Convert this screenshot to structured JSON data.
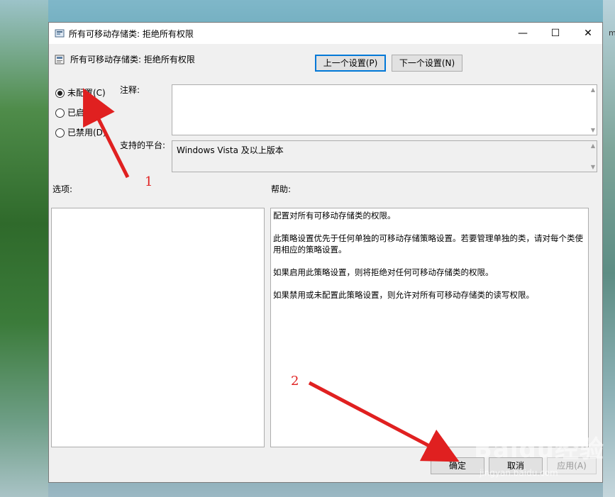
{
  "window": {
    "title": "所有可移动存储类: 拒绝所有权限",
    "controls": {
      "minimize": "—",
      "maximize": "☐",
      "close": "✕"
    }
  },
  "header": {
    "policy_title": "所有可移动存储类: 拒绝所有权限",
    "prev_button": "上一个设置(P)",
    "next_button": "下一个设置(N)"
  },
  "state_options": [
    {
      "label": "未配置(C)",
      "checked": true
    },
    {
      "label": "已启用(E)",
      "checked": false
    },
    {
      "label": "已禁用(D)",
      "checked": false
    }
  ],
  "comment": {
    "label": "注释:",
    "value": ""
  },
  "platform": {
    "label": "支持的平台:",
    "value": "Windows Vista 及以上版本"
  },
  "options": {
    "label": "选项:"
  },
  "help": {
    "label": "帮助:",
    "paragraphs": [
      "配置对所有可移动存储类的权限。",
      "此策略设置优先于任何单独的可移动存储策略设置。若要管理单独的类，请对每个类使用相应的策略设置。",
      "如果启用此策略设置，则将拒绝对任何可移动存储类的权限。",
      "如果禁用或未配置此策略设置，则允许对所有可移动存储类的读写权限。"
    ]
  },
  "footer": {
    "ok": "确定",
    "cancel": "取消",
    "apply": "应用(A)"
  },
  "annotations": {
    "step1": "1",
    "step2": "2"
  },
  "watermark": {
    "brand": "Baidu经验",
    "url": "jingyan.baidu.com"
  },
  "edge_text": "m",
  "colors": {
    "accent": "#0078d7",
    "annotation": "#e02020"
  }
}
